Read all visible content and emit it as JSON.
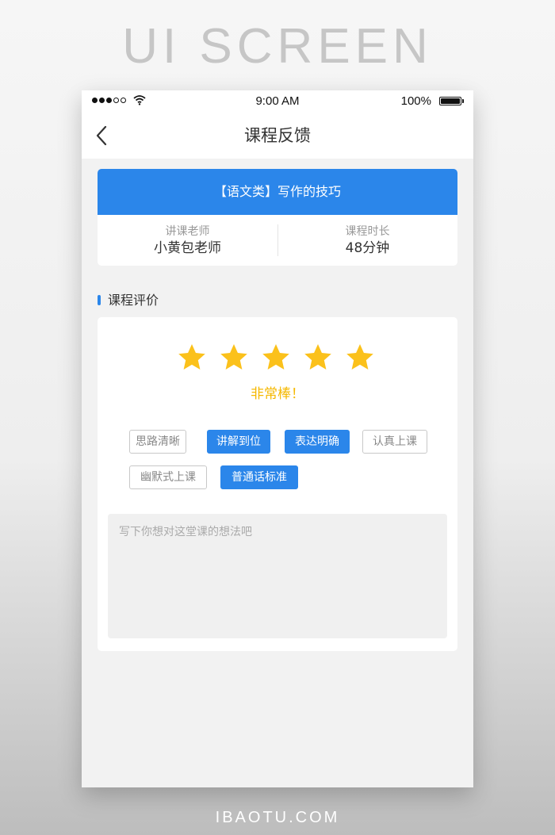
{
  "poster": {
    "title": "UI SCREEN",
    "footer": "IBAOTU.COM"
  },
  "status_bar": {
    "signal_icon": "signal-dots-icon",
    "wifi_icon": "wifi-icon",
    "time": "9:00 AM",
    "battery_percent": "100%",
    "battery_icon": "battery-icon"
  },
  "nav": {
    "back_icon": "chevron-left-icon",
    "title": "课程反馈"
  },
  "course": {
    "title": "【语文类】写作的技巧",
    "teacher_label": "讲课老师",
    "teacher_value": "小黄包老师",
    "duration_label": "课程时长",
    "duration_value": "48分钟"
  },
  "rating": {
    "section_title": "课程评价",
    "stars_filled": 5,
    "stars_total": 5,
    "star_icon": "star-icon",
    "praise": "非常棒！",
    "tags": [
      {
        "label": "思路清晰",
        "selected": false
      },
      {
        "label": "讲解到位",
        "selected": true
      },
      {
        "label": "表达明确",
        "selected": true
      },
      {
        "label": "认真上课",
        "selected": false
      },
      {
        "label": "幽默式上课",
        "selected": false
      },
      {
        "label": "普通话标准",
        "selected": true
      }
    ],
    "feedback_placeholder": "写下你想对这堂课的想法吧",
    "feedback_value": ""
  },
  "colors": {
    "accent": "#2b86ea",
    "star": "#fbc11b",
    "praise": "#f5b800",
    "page_bg": "#f2f2f2"
  }
}
